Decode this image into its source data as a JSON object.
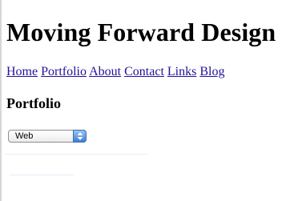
{
  "header": {
    "site_title": "Moving Forward Design"
  },
  "nav": {
    "items": [
      {
        "label": "Home"
      },
      {
        "label": "Portfolio"
      },
      {
        "label": "About"
      },
      {
        "label": "Contact"
      },
      {
        "label": "Links"
      },
      {
        "label": "Blog"
      }
    ]
  },
  "main": {
    "section_title": "Portfolio",
    "category_select": {
      "value": "Web"
    }
  },
  "icons": {
    "select_arrow": "up-down-arrows-icon"
  },
  "colors": {
    "link": "#22119a",
    "select_arrow_blue": "#3d7fd6"
  }
}
